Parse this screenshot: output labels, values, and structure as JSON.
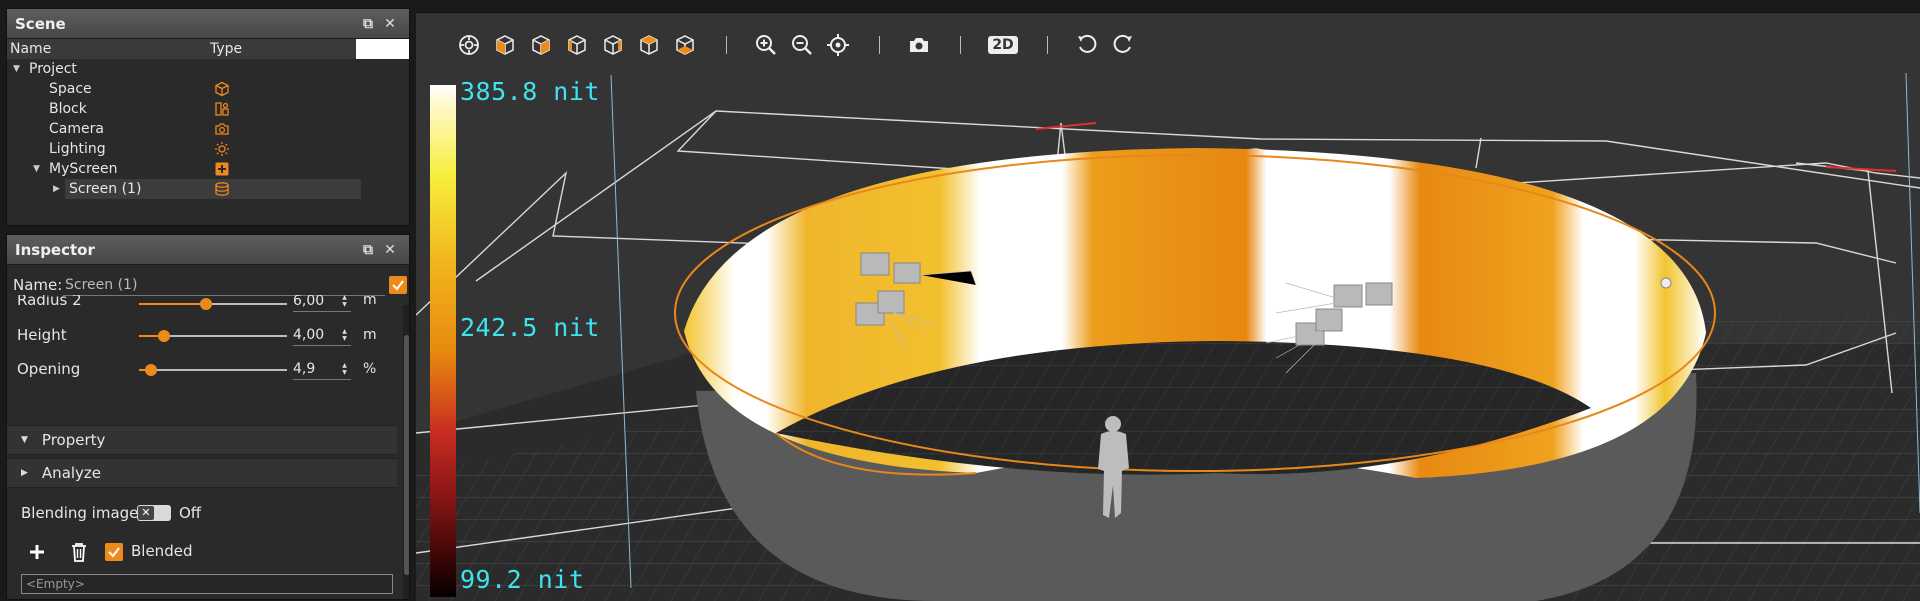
{
  "scene_panel": {
    "title": "Scene",
    "columns": {
      "name": "Name",
      "type": "Type"
    },
    "tree": [
      {
        "label": "Project",
        "level": 0,
        "expanded": true,
        "icon": ""
      },
      {
        "label": "Space",
        "level": 1,
        "icon": "space-cube-icon"
      },
      {
        "label": "Block",
        "level": 1,
        "icon": "block-icon"
      },
      {
        "label": "Camera",
        "level": 1,
        "icon": "camera-icon"
      },
      {
        "label": "Lighting",
        "level": 1,
        "icon": "lighting-sun-icon"
      },
      {
        "label": "MyScreen",
        "level": 1,
        "expanded": true,
        "icon": "screen-group-plus-icon"
      },
      {
        "label": "Screen (1)",
        "level": 2,
        "collapsed": true,
        "selected": true,
        "icon": "cylinder-screen-icon"
      }
    ]
  },
  "inspector": {
    "title": "Inspector",
    "name_label": "Name:",
    "name_value": "Screen (1)",
    "name_enabled": true,
    "params": [
      {
        "label": "Radius 2",
        "value": "6,00",
        "unit": "m",
        "fraction": 0.45
      },
      {
        "label": "Height",
        "value": "4,00",
        "unit": "m",
        "fraction": 0.17
      },
      {
        "label": "Opening",
        "value": "4,9",
        "unit": "%",
        "fraction": 0.08
      }
    ],
    "sections": [
      {
        "label": "Property",
        "expanded": true
      },
      {
        "label": "Analyze",
        "expanded": false
      }
    ],
    "blending_image_label": "Blending image",
    "blending_image_state": "Off",
    "blended_label": "Blended",
    "blended_checked": true,
    "empty_placeholder": "<Empty>"
  },
  "viewport": {
    "toolbar": [
      "view-settings-icon",
      "view-front-icon",
      "view-back-icon",
      "view-left-icon",
      "view-right-icon",
      "view-top-icon",
      "view-bottom-icon",
      "zoom-in-icon",
      "zoom-out-icon",
      "center-target-icon",
      "camera-snapshot-icon",
      "2d-toggle-icon",
      "undo-icon",
      "redo-icon"
    ],
    "mode_2d_label": "2D",
    "legend": {
      "max": "385.8 nit",
      "mid": "242.5 nit",
      "min": "99.2 nit"
    },
    "colors": {
      "accent": "#ee8a1a",
      "legend_text": "#3fe3ef"
    }
  }
}
